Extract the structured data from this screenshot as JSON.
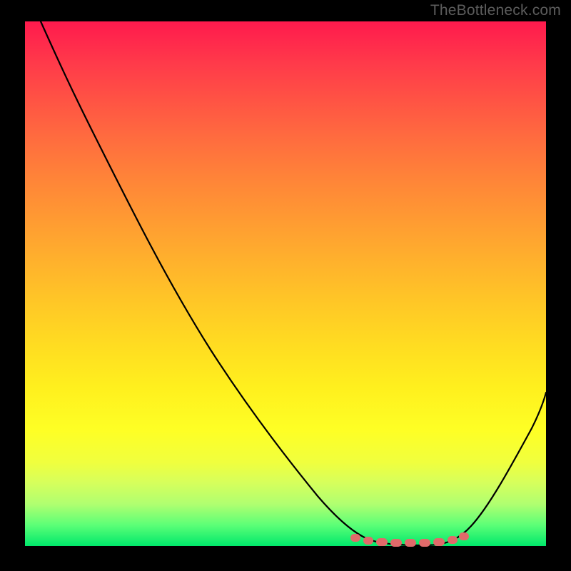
{
  "watermark": "TheBottleneck.com",
  "chart_data": {
    "type": "line",
    "title": "",
    "xlabel": "",
    "ylabel": "",
    "xlim": [
      0,
      100
    ],
    "ylim": [
      0,
      100
    ],
    "series": [
      {
        "name": "bottleneck-curve",
        "x": [
          3,
          10,
          20,
          30,
          40,
          50,
          58,
          63,
          67,
          72,
          77,
          82,
          86,
          90,
          94,
          100
        ],
        "values": [
          100,
          90,
          75,
          60,
          46,
          31,
          19,
          11,
          5,
          1,
          0,
          0,
          3,
          11,
          22,
          42
        ]
      }
    ],
    "annotations": {
      "optimal_zone_x": [
        63,
        85
      ],
      "optimal_zone_y_approx": 1,
      "bumps_x": [
        63.5,
        66,
        68.5,
        71.5,
        74.5,
        77.5,
        80.5,
        83,
        85
      ]
    },
    "colors": {
      "gradient_top": "#ff1a4d",
      "gradient_mid": "#ffd923",
      "gradient_bottom": "#00e86b",
      "curve": "#000000",
      "bump": "#e06a6a"
    }
  }
}
